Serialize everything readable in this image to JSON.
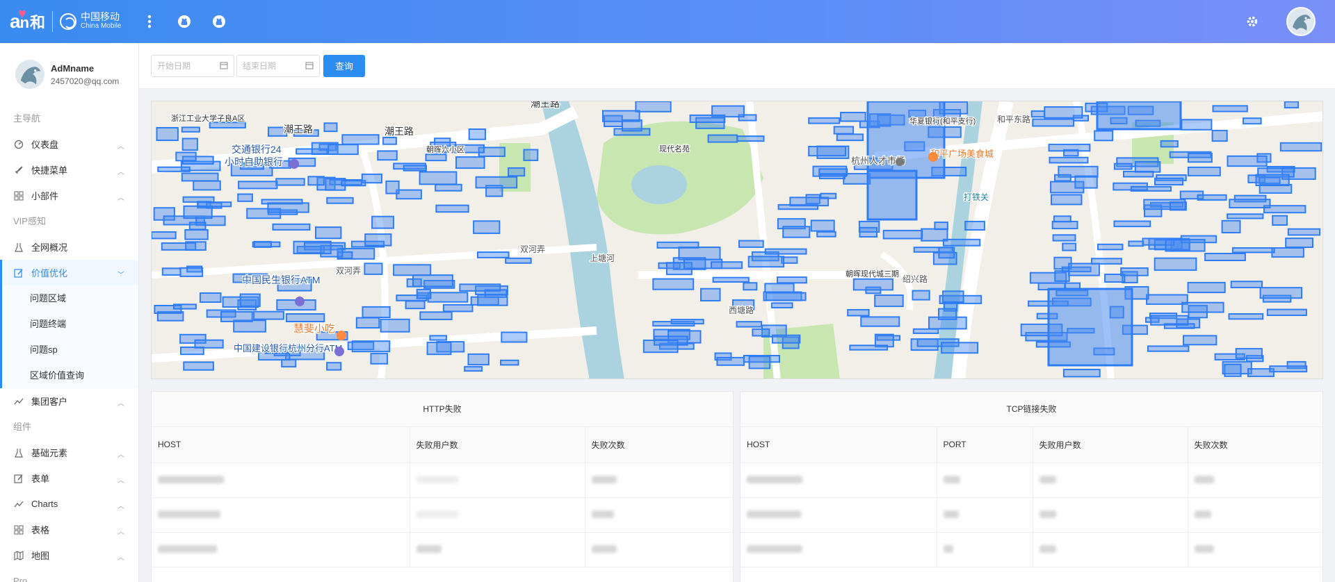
{
  "header": {
    "logo_text": "a",
    "logo_he": "和",
    "brand_cn": "中国移动",
    "brand_en": "China Mobile"
  },
  "user": {
    "name": "AdMname",
    "email": "2457020@qq.com"
  },
  "sidebar": {
    "section_main": "主导航",
    "items_main": [
      {
        "label": "仪表盘",
        "icon": "dashboard-icon"
      },
      {
        "label": "快捷菜单",
        "icon": "rocket-icon"
      },
      {
        "label": "小部件",
        "icon": "grid-icon"
      }
    ],
    "section_vip": "VIP感知",
    "items_vip": [
      {
        "label": "全网概况",
        "icon": "flask-icon"
      },
      {
        "label": "价值优化",
        "icon": "edit-icon"
      }
    ],
    "sub_items": [
      "问题区域",
      "问题终端",
      "问题sp",
      "区域价值查询"
    ],
    "item_group": {
      "label": "集团客户",
      "icon": "trend-icon"
    },
    "section_component": "组件",
    "items_component": [
      {
        "label": "基础元素",
        "icon": "flask-icon"
      },
      {
        "label": "表单",
        "icon": "edit-icon"
      },
      {
        "label": "Charts",
        "icon": "trend-icon"
      },
      {
        "label": "表格",
        "icon": "grid-icon"
      },
      {
        "label": "地图",
        "icon": "map-icon"
      }
    ],
    "section_pro": "Pro"
  },
  "filter": {
    "start_placeholder": "开始日期",
    "end_placeholder": "结束日期",
    "query_label": "查询"
  },
  "map": {
    "labels": [
      "潮王路",
      "潮王路",
      "潮王路",
      "交通银行24",
      "小时自助银行",
      "中国民生银行ATM",
      "双河弄",
      "双河弄",
      "慧斐小吃",
      "中国建设银行杭州分行ATM",
      "上塘河",
      "西塘路",
      "杭州人才市场",
      "和平广场美食城",
      "打铁关",
      "绍兴路",
      "和平东路",
      "浙江工业大学子良A区",
      "朝晖六小区",
      "朝晖现代城三期",
      "现代名苑",
      "华夏银行(和平支行)"
    ]
  },
  "http_panel": {
    "title": "HTTP失败",
    "columns": [
      "HOST",
      "失败用户数",
      "失败次数"
    ]
  },
  "tcp_panel": {
    "title": "TCP链接失败",
    "columns": [
      "HOST",
      "PORT",
      "失败用户数",
      "失败次数"
    ]
  }
}
